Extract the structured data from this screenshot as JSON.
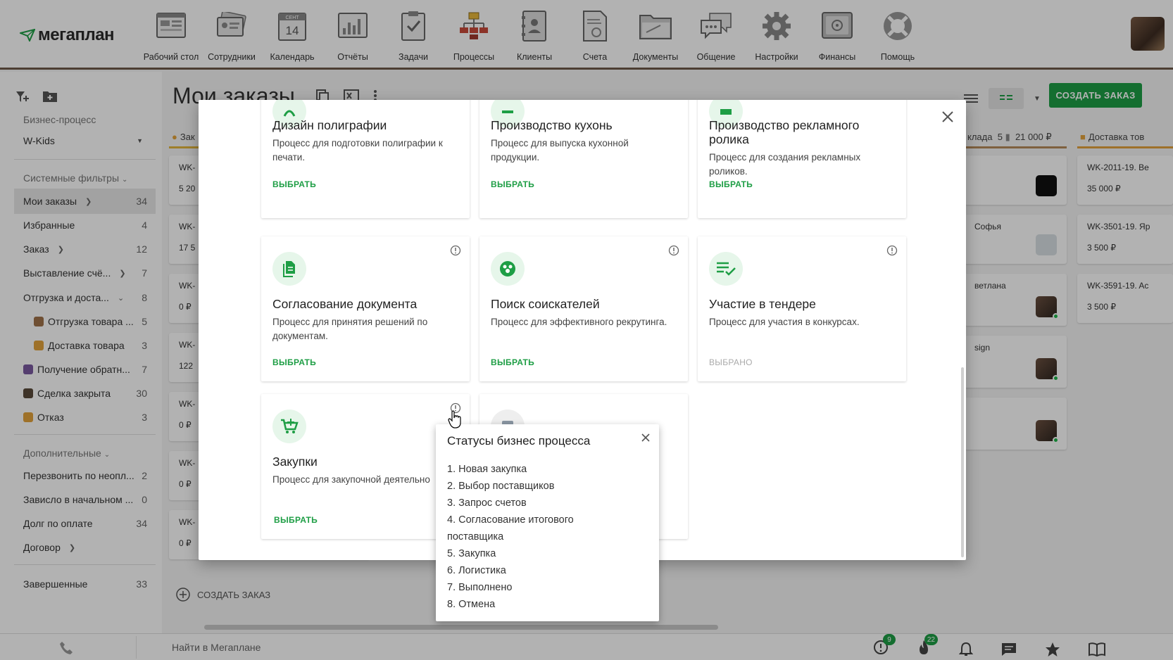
{
  "app": {
    "logo_text": "мегаплан",
    "nav": [
      {
        "label": "Рабочий стол",
        "icon": "desktop-icon"
      },
      {
        "label": "Сотрудники",
        "icon": "employees-icon"
      },
      {
        "label": "Календарь",
        "icon": "calendar-icon",
        "calendar_month": "СЕНТ",
        "calendar_day": "14"
      },
      {
        "label": "Отчёты",
        "icon": "reports-icon"
      },
      {
        "label": "Задачи",
        "icon": "tasks-icon"
      },
      {
        "label": "Процессы",
        "icon": "processes-icon"
      },
      {
        "label": "Клиенты",
        "icon": "clients-icon"
      },
      {
        "label": "Счета",
        "icon": "invoices-icon"
      },
      {
        "label": "Документы",
        "icon": "documents-icon"
      },
      {
        "label": "Общение",
        "icon": "chat-icon"
      },
      {
        "label": "Настройки",
        "icon": "settings-icon"
      },
      {
        "label": "Финансы",
        "icon": "finance-icon"
      },
      {
        "label": "Помощь",
        "icon": "help-icon"
      }
    ]
  },
  "sidebar": {
    "bp_section": "Бизнес-процесс",
    "bp_value": "W-Kids",
    "system_filters": "Системные фильтры",
    "items": [
      {
        "label": "Мои заказы",
        "count": "34",
        "chevron": ">"
      },
      {
        "label": "Избранные",
        "count": "4"
      },
      {
        "label": "Заказ",
        "count": "12",
        "chevron": ">"
      },
      {
        "label": "Выставление счё...",
        "count": "7",
        "chevron": ">"
      },
      {
        "label": "Отгрузка и доста...",
        "count": "8",
        "chevron": "v"
      },
      {
        "label": "Отгрузка товара ...",
        "count": "5"
      },
      {
        "label": "Доставка товара",
        "count": "3"
      },
      {
        "label": "Получение обратн...",
        "count": "7"
      },
      {
        "label": "Сделка закрыта",
        "count": "30"
      },
      {
        "label": "Отказ",
        "count": "3"
      }
    ],
    "extra_section": "Дополнительные",
    "extra_items": [
      {
        "label": "Перезвонить по неопл...",
        "count": "2"
      },
      {
        "label": "Зависло в начальном ...",
        "count": "0"
      },
      {
        "label": "Долг по оплате",
        "count": "34"
      },
      {
        "label": "Договор",
        "count": "",
        "chevron": ">"
      }
    ],
    "finished": {
      "label": "Завершенные",
      "count": "33"
    }
  },
  "main": {
    "title": "Мои заказы",
    "create_button": "СОЗДАТЬ ЗАКАЗ",
    "add_order": "СОЗДАТЬ ЗАКАЗ",
    "col_left_head": "Зак",
    "left_cards": [
      {
        "title": "WK-",
        "sum": "5 20"
      },
      {
        "title": "WK-",
        "sum": "17 5"
      },
      {
        "title": "WK-",
        "sum": "0 ₽"
      },
      {
        "title": "WK-",
        "sum": "122"
      },
      {
        "title": "WK-",
        "sum": "0 ₽"
      },
      {
        "title": "WK-",
        "sum": "0 ₽"
      },
      {
        "title": "WK-",
        "sum": "0 ₽"
      }
    ],
    "col_mid_head": "клада",
    "col_mid_count": "5",
    "col_mid_sum": "21 000 ₽",
    "mid_cards": [
      {
        "text": ""
      },
      {
        "text": "Софья"
      },
      {
        "text": "ветлана"
      },
      {
        "text": "sign"
      },
      {
        "text": ""
      }
    ],
    "col_right_head": "Доставка тов",
    "right_cards": [
      {
        "title": "WK-2011-19. Be",
        "sum": "35 000 ₽"
      },
      {
        "title": "WK-3501-19. Яр",
        "sum": "3 500 ₽"
      },
      {
        "title": "WK-3591-19. Ac",
        "sum": "3 500 ₽"
      }
    ]
  },
  "bottombar": {
    "search_placeholder": "Найти в Мегаплане",
    "alerts_badge": "9",
    "fire_badge": "22"
  },
  "modal": {
    "cards": [
      {
        "title": "Дизайн полиграфии",
        "desc": "Процесс для подготовки полиграфии к печати.",
        "action": "ВЫБРАТЬ"
      },
      {
        "title": "Производство кухонь",
        "desc": "Процесс для выпуска кухонной продукции.",
        "action": "ВЫБРАТЬ"
      },
      {
        "title": "Производство рекламного ролика",
        "desc": "Процесс для создания рекламных роликов.",
        "action": "ВЫБРАТЬ"
      },
      {
        "title": "Согласование документа",
        "desc": "Процесс для принятия решений по документам.",
        "action": "ВЫБРАТЬ"
      },
      {
        "title": "Поиск соискателей",
        "desc": "Процесс для эффективного рекрутинга.",
        "action": "ВЫБРАТЬ"
      },
      {
        "title": "Участие в тендере",
        "desc": "Процесс для участия в конкурсах.",
        "action": "ВЫБРАНО"
      },
      {
        "title": "Закупки",
        "desc": "Процесс для закупочной деятельно",
        "action": "ВЫБРАТЬ"
      }
    ]
  },
  "popover": {
    "title": "Статусы бизнес процесса",
    "statuses": [
      "1. Новая закупка",
      "2. Выбор поставщиков",
      "3. Запрос счетов",
      "4. Согласование итогового поставщика",
      "5. Закупка",
      "6. Логистика",
      "7. Выполнено",
      "8. Отмена"
    ]
  },
  "colors": {
    "accent": "#1e9e45",
    "accent_light": "#e6f6ea",
    "nav_border": "#6d5a4a"
  }
}
